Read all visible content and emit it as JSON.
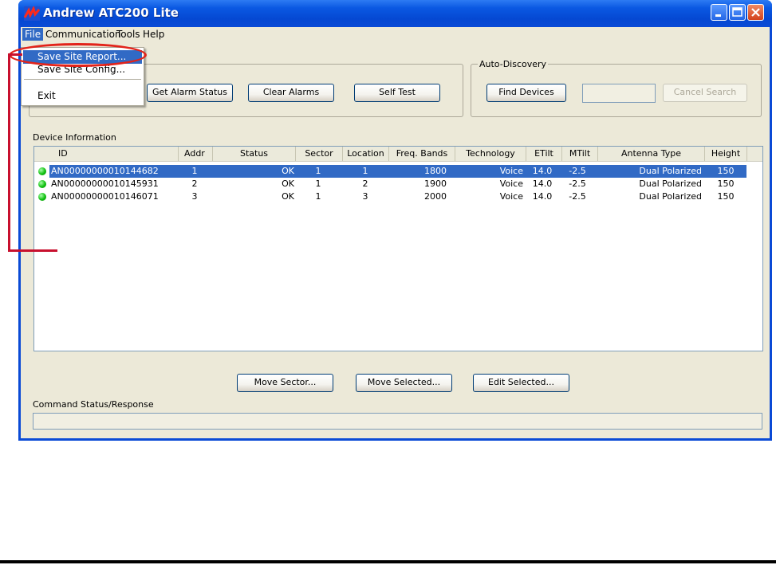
{
  "window": {
    "title": "Andrew ATC200 Lite"
  },
  "menubar": [
    "File",
    "Communication",
    "Tools",
    "Help"
  ],
  "file_menu": [
    "Save Site Report...",
    "Save Site Config...",
    "Exit"
  ],
  "alarm_buttons": [
    "Get Alarm Status",
    "Clear Alarms",
    "Self Test"
  ],
  "auto_discovery": {
    "label": "Auto-Discovery",
    "find_label": "Find Devices",
    "search_value": "",
    "cancel_label": "Cancel Search"
  },
  "device_info": {
    "label": "Device Information",
    "columns": [
      "ID",
      "Addr",
      "Status",
      "Sector",
      "Location",
      "Freq. Bands",
      "Technology",
      "ETilt",
      "MTilt",
      "Antenna Type",
      "Height"
    ],
    "rows": [
      {
        "id": "AN00000000010144682",
        "addr": "1",
        "status": "OK",
        "sector": "1",
        "location": "1",
        "freq": "1800",
        "tech": "Voice",
        "etilt": "14.0",
        "mtilt": "-2.5",
        "antenna": "Dual Polarized",
        "height": "150",
        "selected": true
      },
      {
        "id": "AN00000000010145931",
        "addr": "2",
        "status": "OK",
        "sector": "1",
        "location": "2",
        "freq": "1900",
        "tech": "Voice",
        "etilt": "14.0",
        "mtilt": "-2.5",
        "antenna": "Dual Polarized",
        "height": "150",
        "selected": false
      },
      {
        "id": "AN00000000010146071",
        "addr": "3",
        "status": "OK",
        "sector": "1",
        "location": "3",
        "freq": "2000",
        "tech": "Voice",
        "etilt": "14.0",
        "mtilt": "-2.5",
        "antenna": "Dual Polarized",
        "height": "150",
        "selected": false
      }
    ]
  },
  "action_buttons": [
    "Move Sector...",
    "Move Selected...",
    "Edit Selected..."
  ],
  "status": {
    "label": "Command Status/Response",
    "value": ""
  },
  "colors": {
    "title_blue": "#0a4ad6",
    "selection": "#316ac5",
    "callout_red": "#e2231a",
    "status_ok": "#10c010"
  },
  "icons": [
    "andrew-logo-icon",
    "minimize-icon",
    "maximize-icon",
    "close-icon",
    "status-ok-icon"
  ]
}
